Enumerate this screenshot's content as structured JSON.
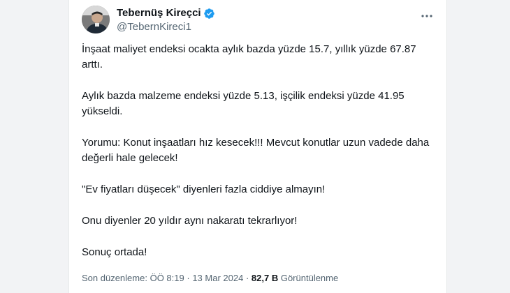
{
  "tweet": {
    "author": {
      "display_name": "Tebernüş Kireçci",
      "handle": "@TebernKireci1",
      "verified": true,
      "avatar_icon": "profile-photo"
    },
    "paragraphs": [
      "İnşaat maliyet endeksi ocakta aylık bazda yüzde 15.7, yıllık yüzde 67.87 arttı.",
      "Aylık bazda malzeme endeksi yüzde 5.13, işçilik endeksi yüzde 41.95 yükseldi.",
      "Yorumu: Konut inşaatları hız kesecek!!! Mevcut konutlar uzun vadede daha değerli hale gelecek!",
      "\"Ev fiyatları düşecek\" diyenleri fazla ciddiye almayın!",
      "Onu diyenler 20 yıldır aynı nakaratı tekrarlıyor!",
      "Sonuç ortada!"
    ],
    "meta": {
      "edited_label": "Son düzenleme:",
      "time": "ÖÖ 8:19",
      "separator": "·",
      "date": "13 Mar 2024",
      "views_count": "82,7 B",
      "views_label": "Görüntülenme"
    },
    "colors": {
      "verified_badge": "#1d9bf0",
      "text_primary": "#0f1419",
      "text_secondary": "#536471"
    }
  }
}
